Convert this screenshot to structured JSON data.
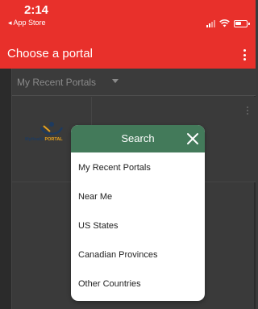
{
  "status_bar": {
    "time": "2:14",
    "back_label": "◂ App Store",
    "icons": [
      "signal-icon",
      "wifi-icon",
      "battery-icon"
    ]
  },
  "app_bar": {
    "title": "Choose a portal",
    "menu_icon": "more-vertical-icon",
    "background_color": "#e8302b"
  },
  "filter": {
    "selected": "My Recent Portals"
  },
  "portal_card": {
    "logo_text_main": "MyHealth",
    "logo_text_second": "PORTAL"
  },
  "search_dialog": {
    "title": "Search",
    "close_icon": "close-icon",
    "header_color": "#437a5a",
    "options": [
      {
        "label": "My Recent Portals"
      },
      {
        "label": "Near Me"
      },
      {
        "label": "US States"
      },
      {
        "label": "Canadian Provinces"
      },
      {
        "label": "Other Countries"
      }
    ]
  }
}
